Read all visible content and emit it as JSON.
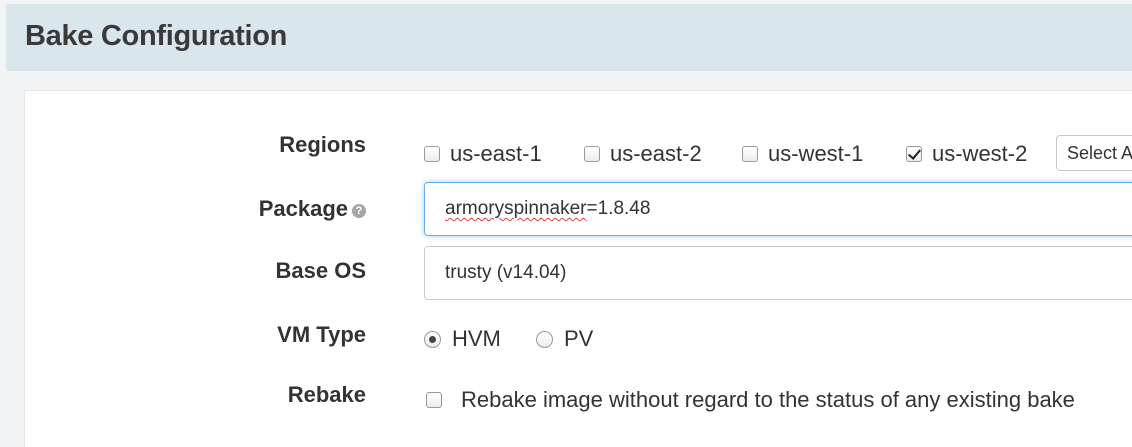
{
  "header": {
    "title": "Bake Configuration"
  },
  "form": {
    "regions": {
      "label": "Regions",
      "options": [
        {
          "label": "us-east-1",
          "checked": false
        },
        {
          "label": "us-east-2",
          "checked": false
        },
        {
          "label": "us-west-1",
          "checked": false
        },
        {
          "label": "us-west-2",
          "checked": true
        }
      ],
      "select_label": "Select A"
    },
    "package": {
      "label": "Package",
      "help_icon": "question-circle-icon",
      "value_prefix": "armoryspinnaker",
      "value_suffix": "=1.8.48"
    },
    "base_os": {
      "label": "Base OS",
      "value": "trusty (v14.04)"
    },
    "vm_type": {
      "label": "VM Type",
      "options": [
        {
          "label": "HVM",
          "selected": true
        },
        {
          "label": "PV",
          "selected": false
        }
      ]
    },
    "rebake": {
      "label": "Rebake",
      "checkbox_label": "Rebake image without regard to the status of any existing bake",
      "checked": false
    }
  },
  "colors": {
    "header_bg": "#d9e6ec",
    "focus_border": "#66afe9"
  }
}
